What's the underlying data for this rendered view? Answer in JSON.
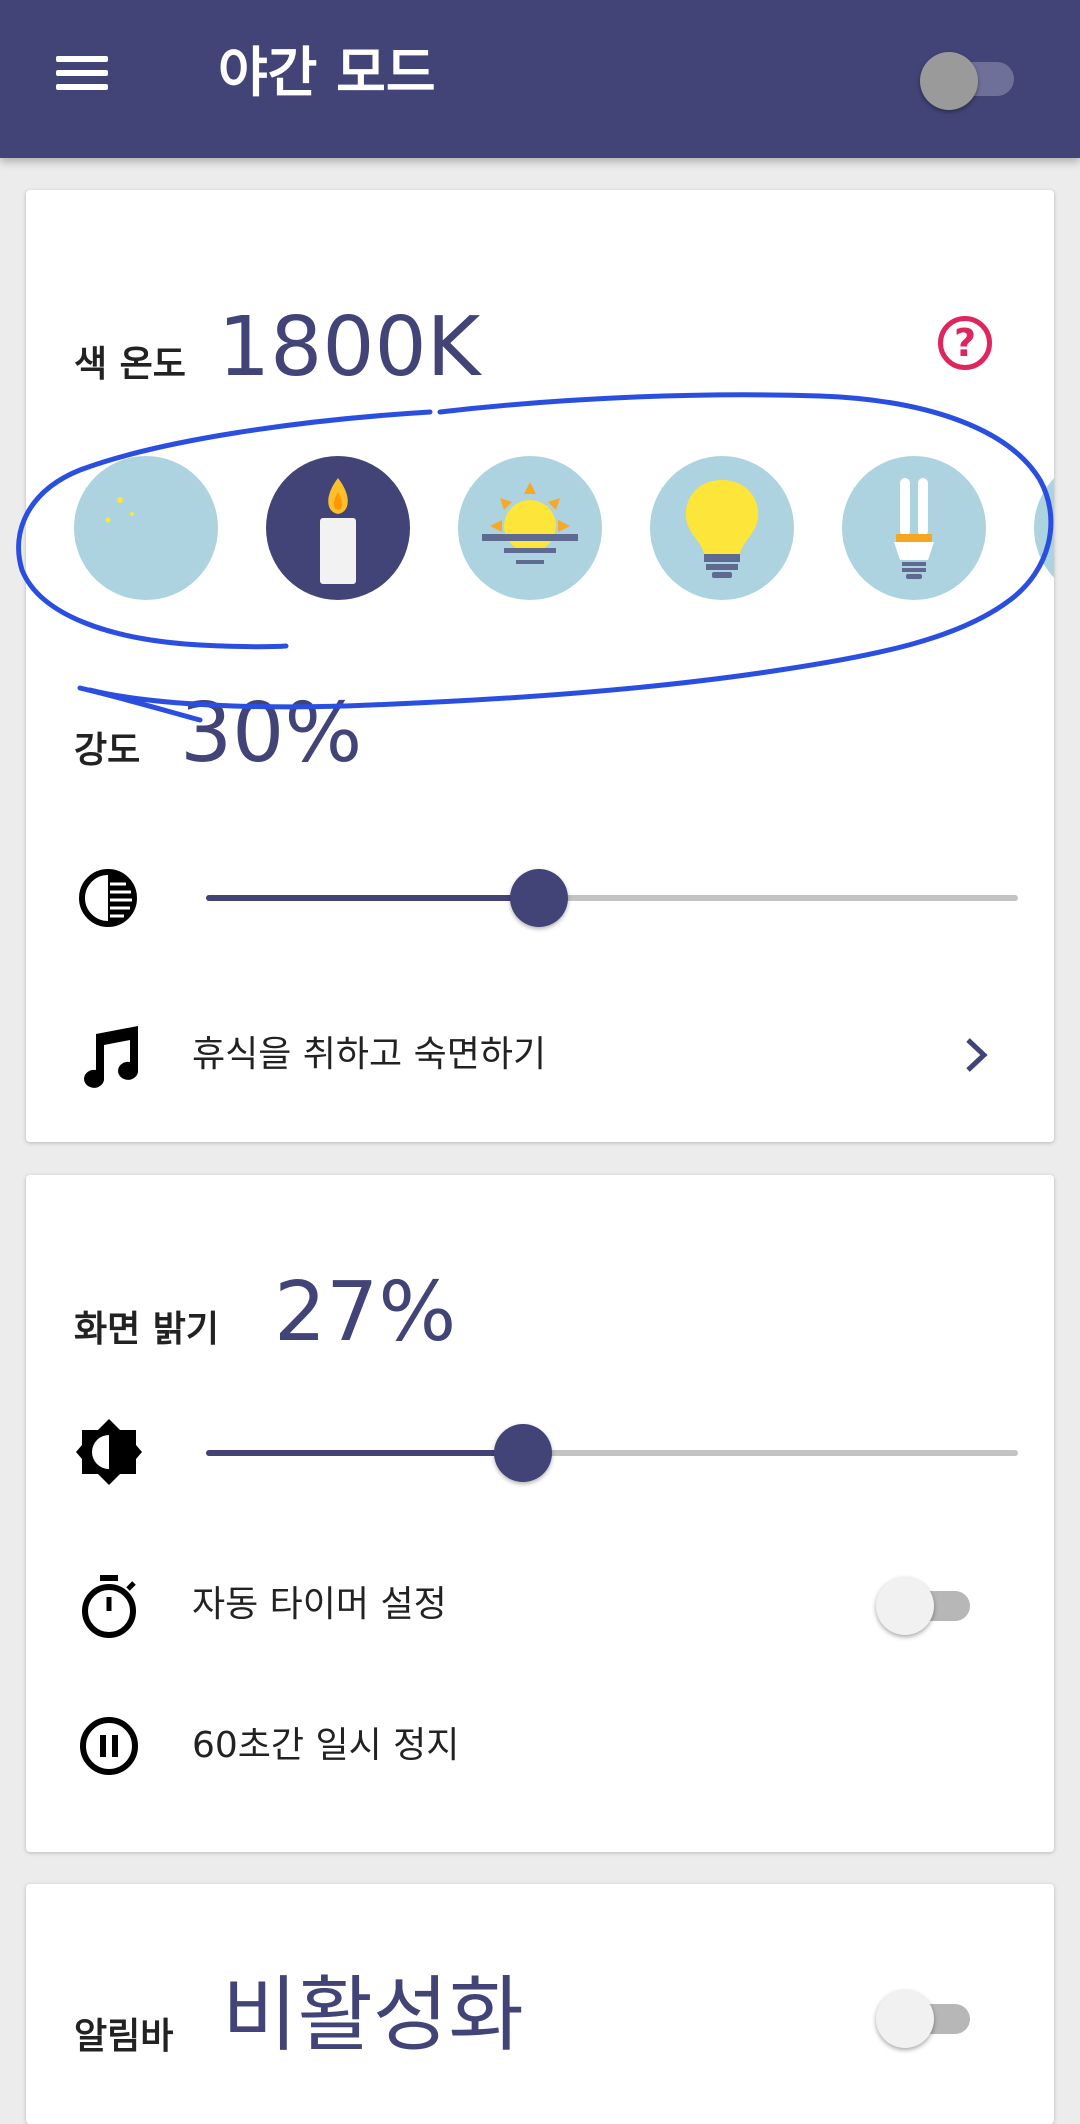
{
  "app_bar": {
    "title": "야간 모드",
    "menu_icon": "hamburger-menu-icon",
    "master_switch_on": false,
    "color": "#424377"
  },
  "color_temperature": {
    "label": "색 온도",
    "value": "1800K",
    "help_icon": "question-circle-icon",
    "help_color": "#e0245e",
    "presets": [
      {
        "icon": "moon-icon",
        "selected": false
      },
      {
        "icon": "candle-icon",
        "selected": true
      },
      {
        "icon": "sunset-icon",
        "selected": false
      },
      {
        "icon": "light-bulb-icon",
        "selected": false
      },
      {
        "icon": "cfl-bulb-icon",
        "selected": false
      }
    ]
  },
  "intensity": {
    "label": "강도",
    "value": "30%",
    "slider_percent": 41,
    "slider_icon": "contrast-icon"
  },
  "sleep_sounds": {
    "label": "휴식을 취하고 숙면하기",
    "icon": "music-note-icon",
    "chevron_icon": "chevron-right-icon"
  },
  "screen_brightness": {
    "label": "화면 밝기",
    "value": "27%",
    "slider_percent": 39,
    "slider_icon": "brightness-icon"
  },
  "auto_timer": {
    "label": "자동 타이머 설정",
    "icon": "stopwatch-icon",
    "enabled": false
  },
  "pause": {
    "label": "60초간 일시 정지",
    "icon": "pause-circle-icon"
  },
  "notification_bar": {
    "label": "알림바",
    "value": "비활성화",
    "enabled": false
  },
  "annotation_color": "#2a4fe0",
  "accent_color": "#424377"
}
